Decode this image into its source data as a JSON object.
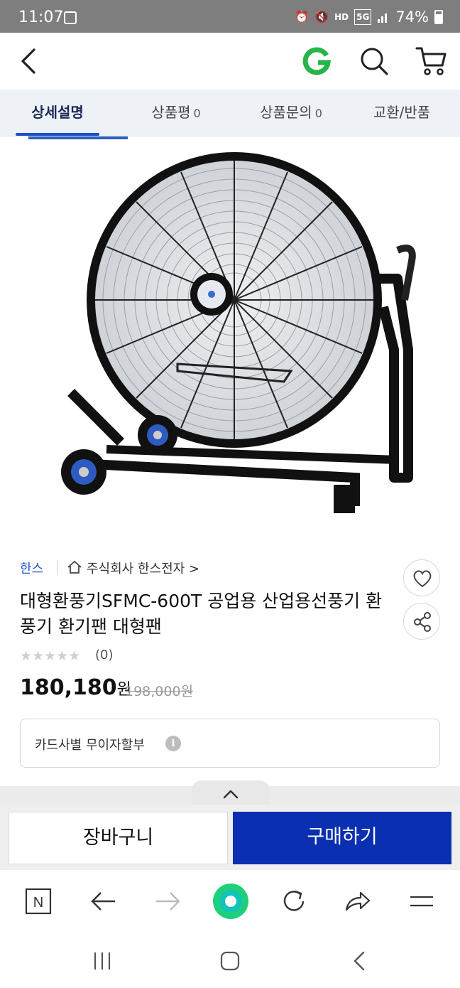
{
  "status_bar": {
    "time": "11:07",
    "battery": "74%",
    "network": "5G",
    "hd_voice": "HD"
  },
  "header": {
    "icons": [
      "back-arrow-icon",
      "gmarket-g-logo",
      "search-icon",
      "cart-icon"
    ],
    "logo_color": "#27b44a"
  },
  "tabs": [
    {
      "label": "상세설명",
      "count": ""
    },
    {
      "label": "상품평",
      "count": "0"
    },
    {
      "label": "상품문의",
      "count": "0"
    },
    {
      "label": "교환/반품",
      "count": ""
    }
  ],
  "product": {
    "brand": "한스",
    "shop": "주식회사 한스전자",
    "shop_chevron": ">",
    "title": "대형환풍기SFMC-600T 공업용 산업용선풍기 환풍기 환기팬 대형팬",
    "rating_stars": "★★★★★",
    "rating_count": "(0)",
    "rating": 0,
    "price": "180,180",
    "price_unit": "원",
    "original_price": "198,000",
    "original_unit": "원",
    "installment_label": "카드사별 무이자할부",
    "info_icon_text": "i"
  },
  "buy_bar": {
    "cart_label": "장바구니",
    "buy_label": "구매하기",
    "buy_color": "#0a2fb0"
  },
  "browser_bar": {
    "icons": [
      "n-home-icon",
      "back-icon",
      "forward-icon",
      "green-circle-icon",
      "refresh-icon",
      "share-icon",
      "menu-icon"
    ],
    "n_label": "N"
  },
  "nav_bar": {
    "icons": [
      "recent-apps-icon",
      "home-icon",
      "back-icon"
    ]
  }
}
